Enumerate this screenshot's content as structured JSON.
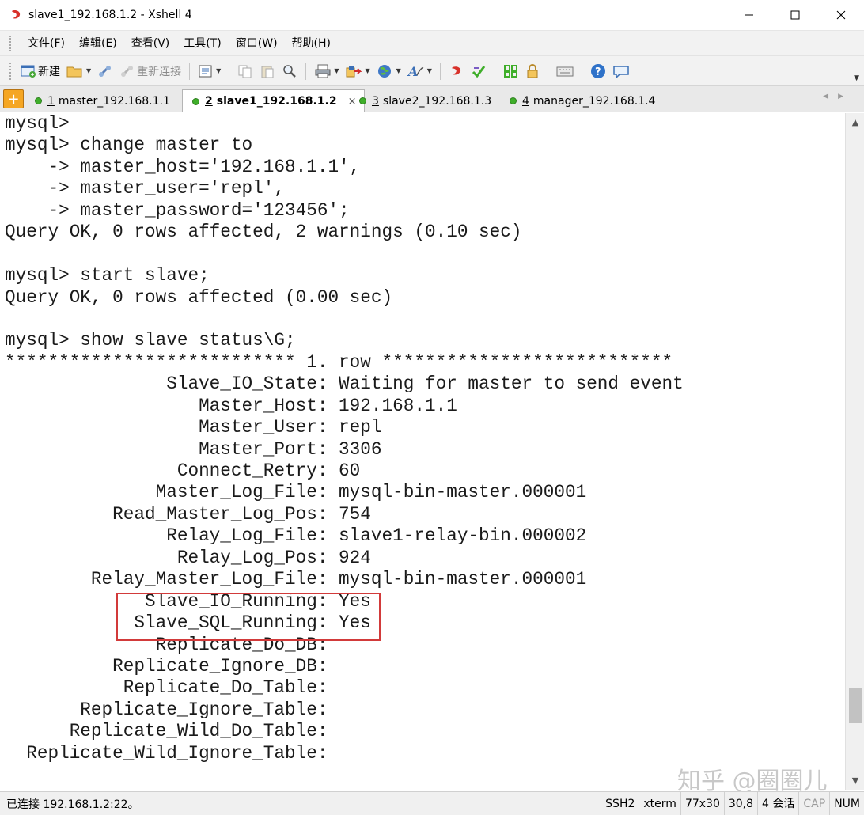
{
  "window": {
    "title": "slave1_192.168.1.2 - Xshell 4",
    "controls": [
      "minimize-icon",
      "maximize-icon",
      "close-icon"
    ]
  },
  "menu": {
    "items": [
      "文件(F)",
      "编辑(E)",
      "查看(V)",
      "工具(T)",
      "窗口(W)",
      "帮助(H)"
    ]
  },
  "toolbar": {
    "new_label": "新建",
    "reconnect_label": "重新连接",
    "icons": [
      "new-session-icon",
      "open-folder-icon",
      "connect-link-icon",
      "reconnect-icon",
      "properties-icon",
      "copy-icon",
      "paste-icon",
      "find-icon",
      "print-icon",
      "transfer-icon",
      "globe-icon",
      "font-icon",
      "xftp-icon",
      "xagent-icon",
      "layout-icon",
      "lock-icon",
      "keyboard-icon",
      "help-icon",
      "chat-icon"
    ]
  },
  "tabs": [
    {
      "num": "1",
      "label": "master_192.168.1.1",
      "active": false
    },
    {
      "num": "2",
      "label": "slave1_192.168.1.2",
      "active": true
    },
    {
      "num": "3",
      "label": "slave2_192.168.1.3",
      "active": false
    },
    {
      "num": "4",
      "label": "manager_192.168.1.4",
      "active": false
    }
  ],
  "terminal": {
    "lines": [
      "mysql>",
      "mysql> change master to",
      "    -> master_host='192.168.1.1',",
      "    -> master_user='repl',",
      "    -> master_password='123456';",
      "Query OK, 0 rows affected, 2 warnings (0.10 sec)",
      "",
      "mysql> start slave;",
      "Query OK, 0 rows affected (0.00 sec)",
      "",
      "mysql> show slave status\\G;",
      "*************************** 1. row ***************************",
      "               Slave_IO_State: Waiting for master to send event",
      "                  Master_Host: 192.168.1.1",
      "                  Master_User: repl",
      "                  Master_Port: 3306",
      "                Connect_Retry: 60",
      "              Master_Log_File: mysql-bin-master.000001",
      "          Read_Master_Log_Pos: 754",
      "               Relay_Log_File: slave1-relay-bin.000002",
      "                Relay_Log_Pos: 924",
      "        Relay_Master_Log_File: mysql-bin-master.000001",
      "             Slave_IO_Running: Yes",
      "            Slave_SQL_Running: Yes",
      "              Replicate_Do_DB:",
      "          Replicate_Ignore_DB:",
      "           Replicate_Do_Table:",
      "       Replicate_Ignore_Table:",
      "      Replicate_Wild_Do_Table:",
      "  Replicate_Wild_Ignore_Table:"
    ],
    "highlight_color": "#d23a3a"
  },
  "watermark": "知乎 @圈圈儿",
  "status": {
    "connection": "已连接 192.168.1.2:22。",
    "protocol": "SSH2",
    "terminal_type": "xterm",
    "size": "77x30",
    "cursor": "30,8",
    "sessions": "4 会话",
    "caps": "CAP",
    "num": "NUM"
  },
  "colors": {
    "tab_active_dot": "#3fae2a",
    "add_tab": "#f5a623"
  }
}
